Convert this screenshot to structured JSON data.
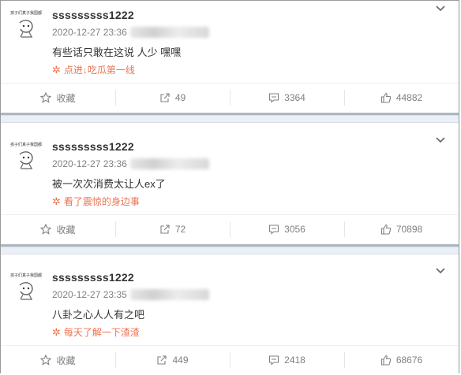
{
  "posts": [
    {
      "username": "sssssssss1222",
      "timestamp": "2020-12-27 23:36",
      "content": "有些话只敢在这说 人少 嘿嘿",
      "topic": "点进↓吃瓜第一线",
      "actions": {
        "favorite": "收藏",
        "repost": "49",
        "comment": "3364",
        "like": "44882"
      }
    },
    {
      "username": "sssssssss1222",
      "timestamp": "2020-12-27 23:36",
      "content": "被一次次消费太让人ex了",
      "topic": "看了震惊的身边事",
      "actions": {
        "favorite": "收藏",
        "repost": "72",
        "comment": "3056",
        "like": "70898"
      }
    },
    {
      "username": "sssssssss1222",
      "timestamp": "2020-12-27 23:35",
      "content": "八卦之心人人有之吧",
      "topic": "每天了解一下渣渣",
      "actions": {
        "favorite": "收藏",
        "repost": "449",
        "comment": "2418",
        "like": "68676"
      }
    }
  ],
  "avatar_caption": "孩子们真子我国都看",
  "colors": {
    "accent": "#eb7350",
    "meta": "#808080",
    "separator": "#eaf0f5"
  }
}
